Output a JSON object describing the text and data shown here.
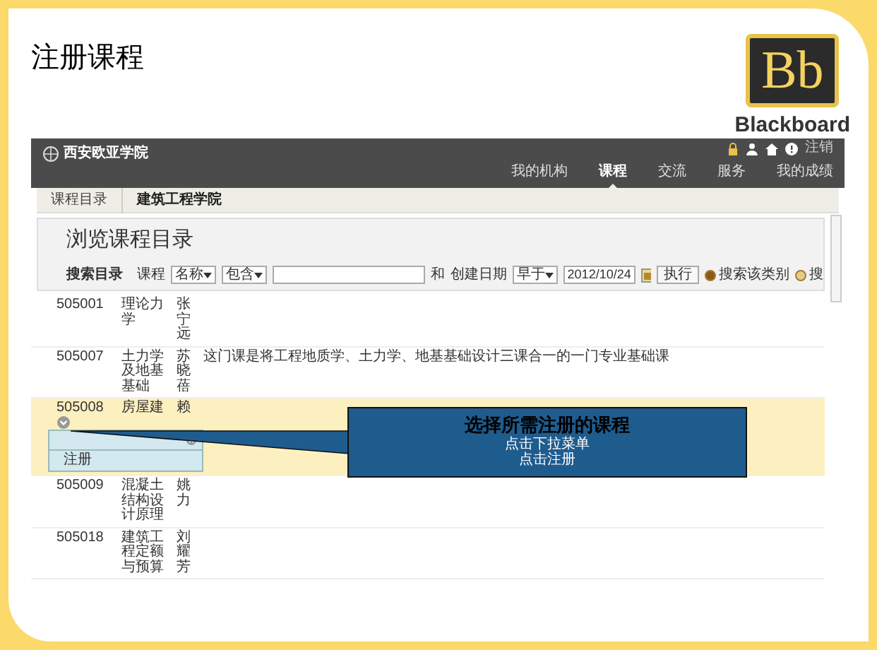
{
  "slide": {
    "title": "注册课程"
  },
  "logo": {
    "mark": "Bb",
    "name": "Blackboard"
  },
  "header": {
    "school": "西安欧亚学院",
    "utility_link": "注销"
  },
  "nav": [
    {
      "label": "我的机构",
      "selected": false
    },
    {
      "label": "课程",
      "selected": true
    },
    {
      "label": "交流",
      "selected": false
    },
    {
      "label": "服务",
      "selected": false
    },
    {
      "label": "我的成绩",
      "selected": false
    }
  ],
  "breadcrumb": [
    "课程目录",
    "建筑工程学院"
  ],
  "page_title": "浏览课程目录",
  "search": {
    "label": "搜索目录",
    "field_label": "课程",
    "field_select": "名称",
    "operator_select": "包含",
    "and_label": "和",
    "date_label": "创建日期",
    "date_operator": "早于",
    "date_value": "2012/10/24",
    "go_button": "执行",
    "radios": [
      {
        "label": "搜索该类别",
        "selected": true
      },
      {
        "label": "搜",
        "selected": false
      }
    ]
  },
  "rows": [
    {
      "id": "505001",
      "name": "理论力学",
      "teacher": "张宁远",
      "highlighted": false
    },
    {
      "id": "505007",
      "name": "土力学及地基基础",
      "teacher": "苏晓蓓",
      "description": "这门课是将工程地质学、土力学、地基基础设计三课合一的一门专业基础课",
      "highlighted": false
    },
    {
      "id": "505008",
      "name": "房屋建",
      "teacher": "赖",
      "highlighted": true,
      "menu": {
        "items": [
          "注册"
        ]
      }
    },
    {
      "id": "505009",
      "name": "混凝土结构设计原理",
      "teacher": "姚力",
      "highlighted": false
    },
    {
      "id": "505018",
      "name": "建筑工程定额与预算",
      "teacher": "刘耀芳",
      "highlighted": false
    }
  ],
  "callout": {
    "title": "选择所需注册的课程",
    "lines": [
      "点击下拉菜单",
      "点击注册"
    ]
  }
}
